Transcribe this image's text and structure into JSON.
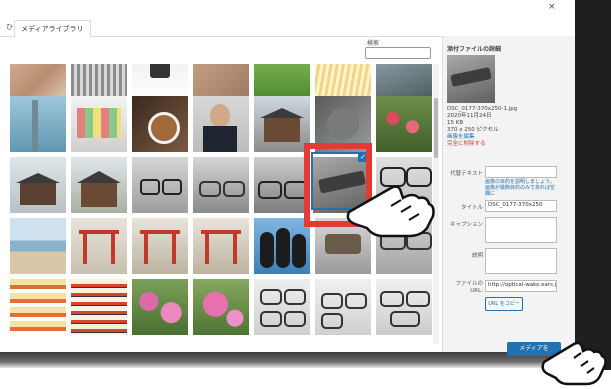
{
  "modal": {
    "tab_prefix": "ひ",
    "tab_label": "メディアライブラリ",
    "close_glyph": "×"
  },
  "search": {
    "label": "検索",
    "placeholder": ""
  },
  "details": {
    "title": "添付ファイルの詳細",
    "filename": "DSC_0177-370x250-1.jpg",
    "date": "2020年11月24日",
    "filesize": "15 KB",
    "dimensions": "370 x 250 ピクセル",
    "edit_link": "画像を編集",
    "delete_link": "完全に削除する"
  },
  "fields": {
    "alt_label": "代替テキスト",
    "alt_help": "画像の目的を説明しましょう。画像が装飾目的のみであれば空欄に",
    "title_label": "タイトル",
    "title_value": "DSC_0177-370x250",
    "caption_label": "キャプション",
    "description_label": "説明",
    "url_label": "ファイルの URL:",
    "url_value": "http://optical-wako.ears.jp",
    "copy_button": "URL をコピー"
  },
  "footer": {
    "insert_button": "メディアを"
  },
  "colors": {
    "accent": "#2271b1",
    "highlight": "#e53935",
    "danger": "#d63638"
  }
}
